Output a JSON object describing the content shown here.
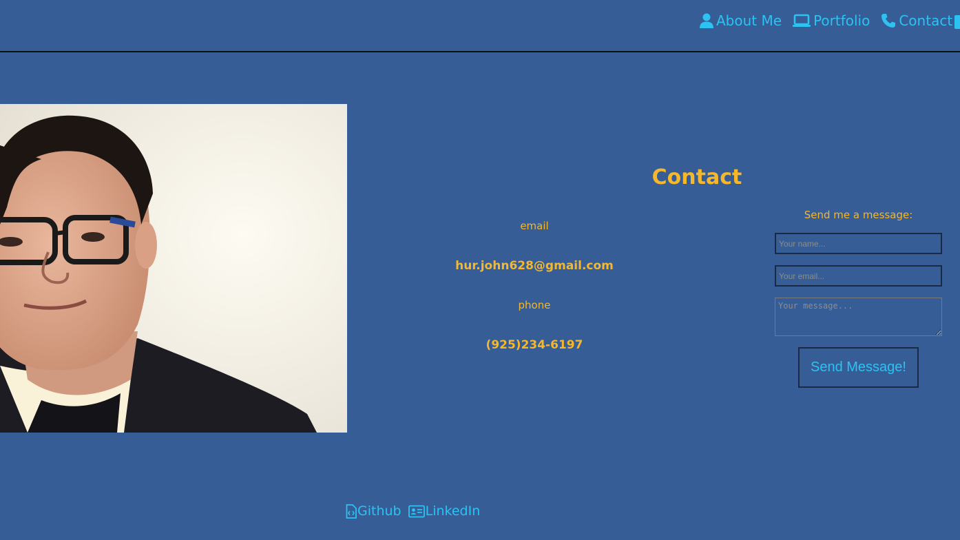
{
  "nav": {
    "items": [
      {
        "label": "About Me",
        "icon": "user-icon"
      },
      {
        "label": "Portfolio",
        "icon": "laptop-icon"
      },
      {
        "label": "Contact",
        "icon": "phone-icon"
      }
    ]
  },
  "contact": {
    "title": "Contact",
    "email_label": "email",
    "email_value": "hur.john628@gmail.com",
    "phone_label": "phone",
    "phone_value": "(925)234-6197"
  },
  "form": {
    "heading": "Send me a message:",
    "name_placeholder": "Your name...",
    "email_placeholder": "Your email...",
    "message_placeholder": "Your message...",
    "submit_label": "Send Message!"
  },
  "footer": {
    "github_label": "Github",
    "linkedin_label": "LinkedIn"
  },
  "colors": {
    "background": "#365d96",
    "accent_gold": "#f5b72b",
    "link_cyan": "#2cc2f2"
  }
}
